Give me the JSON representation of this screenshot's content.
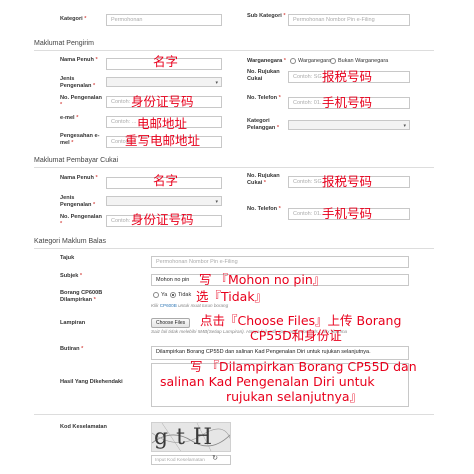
{
  "top": {
    "kategori_label": "Kategori",
    "kategori_placeholder": "Permohonan",
    "sub_kategori_label": "Sub Kategori",
    "sub_kategori_placeholder": "Permohonan Nombor Pin e-Filing"
  },
  "pengirim": {
    "section_title": "Maklumat Pengirim",
    "nama_label": "Nama Penuh",
    "warganegara_label": "Warganegara",
    "warganegara_options": [
      "Warganegara",
      "Bukan Warganegara"
    ],
    "jenis_label": "Jenis Pengenalan",
    "rujukan_label": "No. Rujukan Cukai",
    "rujukan_placeholder": "Contoh: SG...",
    "pengenalan_label": "No. Pengenalan",
    "pengenalan_placeholder": "Contoh: ...",
    "telefon_label": "No. Telefon",
    "telefon_placeholder": "Contoh: 01...",
    "email_label": "e-mel",
    "email_placeholder": "Contoh: ...",
    "kategori_pelanggan_label": "Kategori Pelanggan",
    "pengesahan_label": "Pengesahan e-mel",
    "pengesahan_placeholder": "Contoh: ..."
  },
  "pembayar": {
    "section_title": "Maklumat Pembayar Cukai",
    "nama_label": "Nama Penuh",
    "rujukan_label": "No. Rujukan Cukai",
    "rujukan_placeholder": "Contoh: SG...",
    "jenis_label": "Jenis Pengenalan",
    "pengenalan_label": "No. Pengenalan",
    "pengenalan_placeholder": "Contoh: ...",
    "telefon_label": "No. Telefon",
    "telefon_placeholder": "Contoh: 01..."
  },
  "balas": {
    "section_title": "Kategori Maklum Balas",
    "tajuk_label": "Tajuk",
    "tajuk_placeholder": "Permohonan Nombor Pin e-Filing",
    "subjek_label": "Subjek",
    "subjek_value": "Mohon no pin",
    "cp600b_label": "Borang CP600B Dilampirkan",
    "opt_ya": "Ya",
    "opt_tidak": "Tidak",
    "cp600b_hint_prefix": "Klik ",
    "cp600b_hint_link": "CP600B",
    "cp600b_hint_suffix": " untuk muat turun borang",
    "lampiran_label": "Lampiran",
    "choose_files": "Choose Files",
    "no_file": "No file chosen",
    "lampiran_hint": "Saiz fail tidak melebihi 5MB(Setiap Lampiran). Hanya fail .pdf, .jpg, .png, .doc, .xls, .xlsx diterima",
    "butiran_label": "Butiran",
    "butiran_value": "Dilampirkan Borang CP55D dan salinan Kad Pengenalan Diri untuk rujukan selanjutnya.",
    "hasil_label": "Hasil Yang Dikehendaki",
    "kod_label": "Kod Keselamatan",
    "captcha_text": "gtH",
    "captcha_placeholder": "Input Kod Keselamatan"
  },
  "annotations": {
    "name": "名字",
    "tax_no": "报税号码",
    "ic_no": "身份证号码",
    "phone": "手机号码",
    "email": "电邮地址",
    "email_repeat": "重写电邮地址",
    "name2": "名字",
    "tax_no2": "报税号码",
    "ic_no2": "身份证号码",
    "phone2": "手机号码",
    "write_subject": "写 『Mohon no pin』",
    "choose_tidak": "选『Tidak』",
    "upload_line1": "点击『Choose Files』上传 Borang",
    "upload_line2": "CP55D和身份证",
    "write_butiran_line1": "写 『Dilampirkan Borang CP55D dan",
    "write_butiran_line2": "salinan Kad Pengenalan Diri untuk",
    "write_butiran_line3": "rujukan selanjutnya』"
  },
  "colors": {
    "annotation": "#e8001c",
    "required": "#d9534f",
    "link": "#337ab7"
  }
}
